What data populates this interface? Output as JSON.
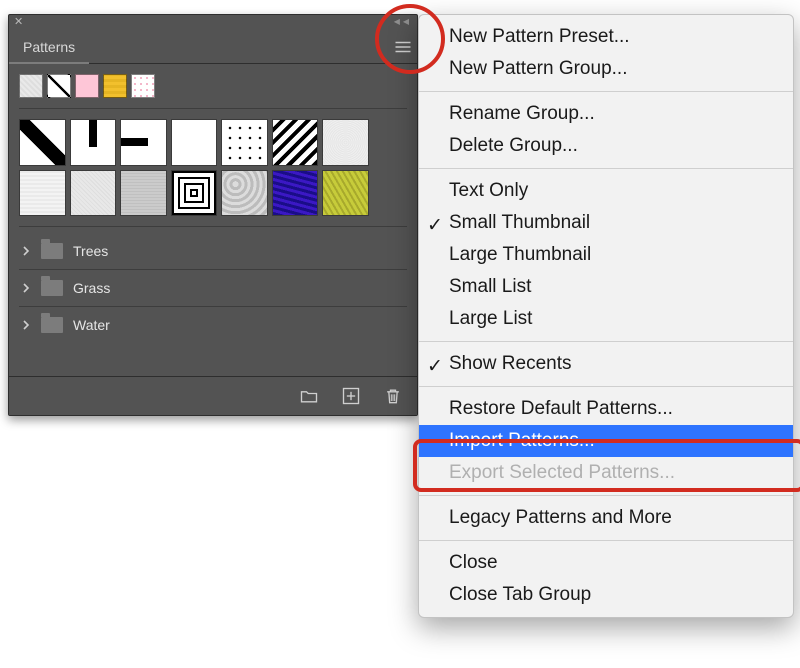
{
  "panel": {
    "tab_label": "Patterns",
    "folders": [
      {
        "label": "Trees"
      },
      {
        "label": "Grass"
      },
      {
        "label": "Water"
      }
    ]
  },
  "menu": {
    "groups": [
      [
        {
          "key": "new_pattern_preset",
          "label": "New Pattern Preset...",
          "selected": false,
          "checked": false,
          "disabled": false
        },
        {
          "key": "new_pattern_group",
          "label": "New Pattern Group...",
          "selected": false,
          "checked": false,
          "disabled": false
        }
      ],
      [
        {
          "key": "rename_group",
          "label": "Rename Group...",
          "selected": false,
          "checked": false,
          "disabled": false
        },
        {
          "key": "delete_group",
          "label": "Delete Group...",
          "selected": false,
          "checked": false,
          "disabled": false
        }
      ],
      [
        {
          "key": "text_only",
          "label": "Text Only",
          "selected": false,
          "checked": false,
          "disabled": false
        },
        {
          "key": "small_thumbnail",
          "label": "Small Thumbnail",
          "selected": false,
          "checked": true,
          "disabled": false
        },
        {
          "key": "large_thumbnail",
          "label": "Large Thumbnail",
          "selected": false,
          "checked": false,
          "disabled": false
        },
        {
          "key": "small_list",
          "label": "Small List",
          "selected": false,
          "checked": false,
          "disabled": false
        },
        {
          "key": "large_list",
          "label": "Large List",
          "selected": false,
          "checked": false,
          "disabled": false
        }
      ],
      [
        {
          "key": "show_recents",
          "label": "Show Recents",
          "selected": false,
          "checked": true,
          "disabled": false
        }
      ],
      [
        {
          "key": "restore_defaults",
          "label": "Restore Default Patterns...",
          "selected": false,
          "checked": false,
          "disabled": false
        },
        {
          "key": "import_patterns",
          "label": "Import Patterns...",
          "selected": true,
          "checked": false,
          "disabled": false
        },
        {
          "key": "export_selected",
          "label": "Export Selected Patterns...",
          "selected": false,
          "checked": false,
          "disabled": true
        }
      ],
      [
        {
          "key": "legacy_patterns",
          "label": "Legacy Patterns and More",
          "selected": false,
          "checked": false,
          "disabled": false
        }
      ],
      [
        {
          "key": "close",
          "label": "Close",
          "selected": false,
          "checked": false,
          "disabled": false
        },
        {
          "key": "close_tab_group",
          "label": "Close Tab Group",
          "selected": false,
          "checked": false,
          "disabled": false
        }
      ]
    ]
  }
}
